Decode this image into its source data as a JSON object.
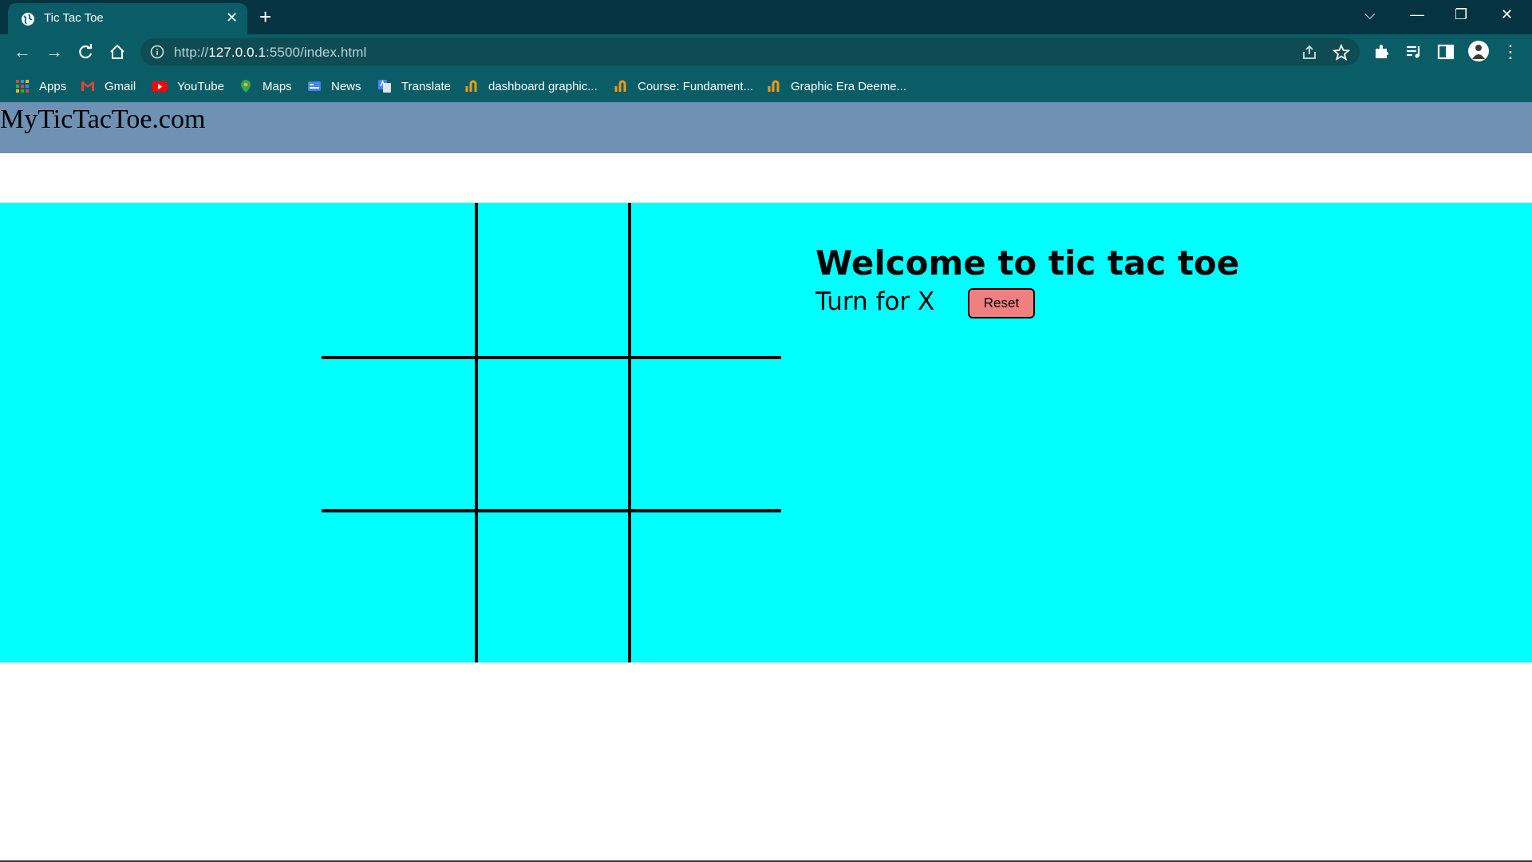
{
  "browser": {
    "tab": {
      "title": "Tic Tac Toe",
      "close": "✕"
    },
    "new_tab": "+",
    "window_controls": {
      "tab_search": "⌵",
      "minimize": "—",
      "restore": "❐",
      "close": "✕"
    },
    "url": {
      "scheme": "http://",
      "host": "127.0.0.1",
      "rest": ":5500/index.html"
    },
    "bookmarks": [
      {
        "label": "Apps",
        "icon": "apps-grid-icon"
      },
      {
        "label": "Gmail",
        "icon": "gmail-icon"
      },
      {
        "label": "YouTube",
        "icon": "youtube-icon"
      },
      {
        "label": "Maps",
        "icon": "maps-icon"
      },
      {
        "label": "News",
        "icon": "news-icon"
      },
      {
        "label": "Translate",
        "icon": "translate-icon"
      },
      {
        "label": "dashboard graphic...",
        "icon": "coursera-icon"
      },
      {
        "label": "Course: Fundament...",
        "icon": "coursera-icon"
      },
      {
        "label": "Graphic Era Deeme...",
        "icon": "coursera-icon"
      }
    ]
  },
  "page": {
    "brand": "MyTicTacToe.com",
    "welcome": "Welcome to tic tac toe",
    "turn": "Turn for X",
    "reset_label": "Reset",
    "board": [
      "",
      "",
      "",
      "",
      "",
      "",
      "",
      "",
      ""
    ]
  },
  "colors": {
    "tabstrip": "#053440",
    "toolbar": "#0a5d66",
    "navbar": "#6e91b4",
    "game_area": "#00ffff",
    "reset_button": "#f08080"
  }
}
